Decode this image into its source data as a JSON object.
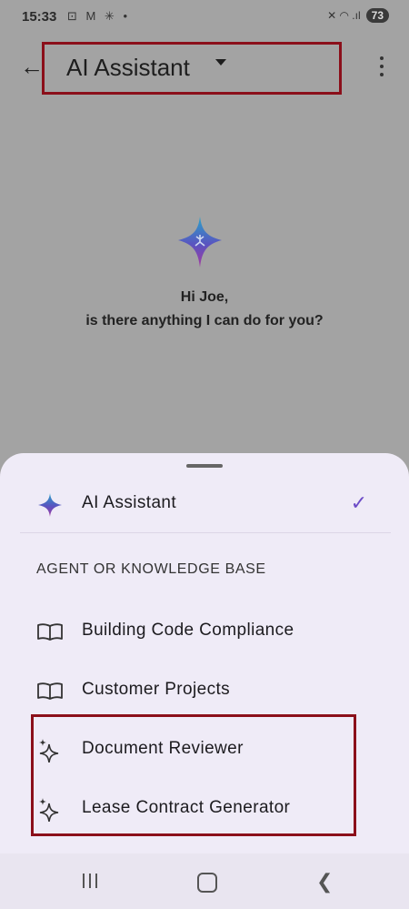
{
  "status": {
    "time": "15:33",
    "icons": "⊡ M ✳ •",
    "right": "✕ ◠ .ıl",
    "battery": "73"
  },
  "appbar": {
    "title": "AI Assistant",
    "back_icon": "arrow-left-icon",
    "menu_icon": "more-vert-icon"
  },
  "greeting": {
    "line1": "Hi Joe,",
    "line2": "is there anything I can do for you?"
  },
  "sheet": {
    "selected": {
      "label": "AI Assistant",
      "icon": "ai-star-icon",
      "checked": true
    },
    "section_label": "AGENT OR KNOWLEDGE BASE",
    "items": [
      {
        "label": "Building Code Compliance",
        "icon": "book-icon"
      },
      {
        "label": "Customer Projects",
        "icon": "book-icon"
      },
      {
        "label": "Document Reviewer",
        "icon": "sparkle-icon"
      },
      {
        "label": "Lease Contract Generator",
        "icon": "sparkle-icon"
      }
    ]
  },
  "colors": {
    "accent": "#6c4bc7",
    "highlight": "#8b0f1a",
    "scrim": "#a3a3a3",
    "sheet": "#efebf7"
  }
}
